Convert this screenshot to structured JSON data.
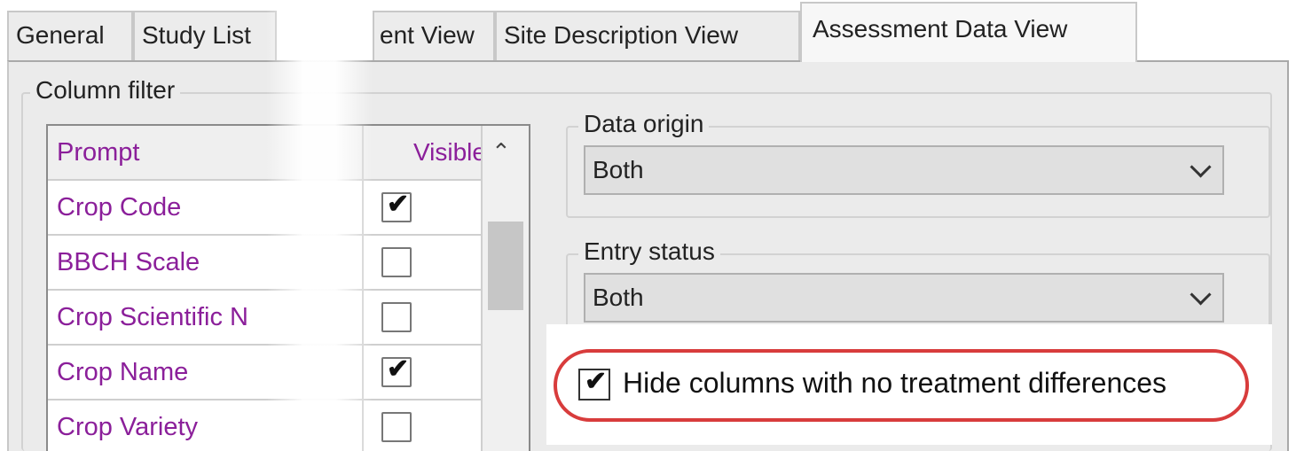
{
  "tabs": [
    {
      "label": "General",
      "active": false
    },
    {
      "label": "Study List",
      "active": false
    },
    {
      "label": "ent View",
      "active": false
    },
    {
      "label": "Site Description View",
      "active": false
    },
    {
      "label": "Assessment Data View",
      "active": true
    }
  ],
  "column_filter": {
    "legend": "Column filter",
    "headers": {
      "prompt": "Prompt",
      "visible": "Visible"
    },
    "rows": [
      {
        "prompt": "Crop Code",
        "visible": true
      },
      {
        "prompt": "BBCH Scale",
        "visible": false
      },
      {
        "prompt": "Crop Scientific N",
        "visible": false
      },
      {
        "prompt": "Crop Name",
        "visible": true
      },
      {
        "prompt": "Crop Variety",
        "visible": false
      }
    ]
  },
  "data_origin": {
    "legend": "Data origin",
    "value": "Both"
  },
  "entry_status": {
    "legend": "Entry status",
    "value": "Both"
  },
  "hide_columns": {
    "label": "Hide columns with no treatment differences",
    "checked": true
  },
  "colors": {
    "prompt_text": "#8b1f9a",
    "highlight": "#d83c3c"
  }
}
